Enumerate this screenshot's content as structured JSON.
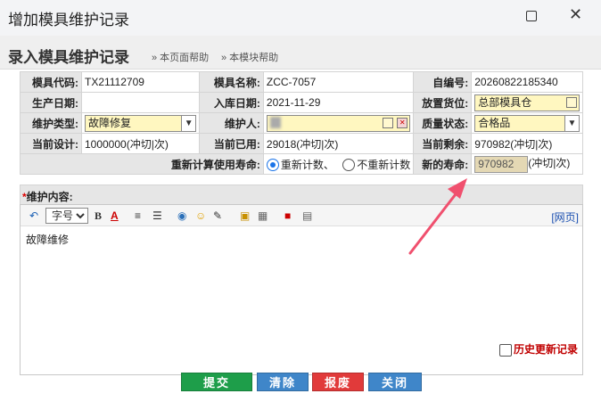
{
  "window": {
    "title": "增加模具维护记录",
    "maximize_glyph": "▢",
    "close_glyph": "✕"
  },
  "header": {
    "title": "录入模具维护记录",
    "help_page": "» 本页面帮助",
    "help_module": "» 本模块帮助"
  },
  "form": {
    "mold_code_label": "模具代码:",
    "mold_code": "TX21112709",
    "mold_name_label": "模具名称:",
    "mold_name": "ZCC-7057",
    "serial_label": "自编号:",
    "serial": "20260822185340",
    "produce_date_label": "生产日期:",
    "produce_date": "",
    "stock_date_label": "入库日期:",
    "stock_date": "2021-11-29",
    "location_label": "放置货位:",
    "location": "总部模具仓",
    "maint_type_label": "维护类型:",
    "maint_type": "故障修复",
    "maintainer_label": "维护人:",
    "quality_label": "质量状态:",
    "quality": "合格品",
    "design_label": "当前设计:",
    "design": "1000000(冲切|次)",
    "used_label": "当前已用:",
    "used": "29018(冲切|次)",
    "remain_label": "当前剩余:",
    "remain": "970982(冲切|次)",
    "recalc_label": "重新计算使用寿命:",
    "recalc_option1": "重新计数、",
    "recalc_option2": "不重新计数",
    "new_life_label": "新的寿命:",
    "new_life": "970982",
    "new_life_unit": "(冲切|次)"
  },
  "content": {
    "label": "维护内容:",
    "required_mark": "*",
    "font_size_option": "字号",
    "web_link": "[网页]",
    "text": "故障维修"
  },
  "history_label": "历史更新记录",
  "buttons": {
    "submit": "提交",
    "clear": "清除",
    "scrap": "报废",
    "close": "关闭"
  },
  "colors": {
    "yellow_field": "#fff7c0",
    "submit": "#1e9e4a",
    "blue": "#3f86c9",
    "scrap": "#e13a3a",
    "arrow": "#f0506e"
  }
}
